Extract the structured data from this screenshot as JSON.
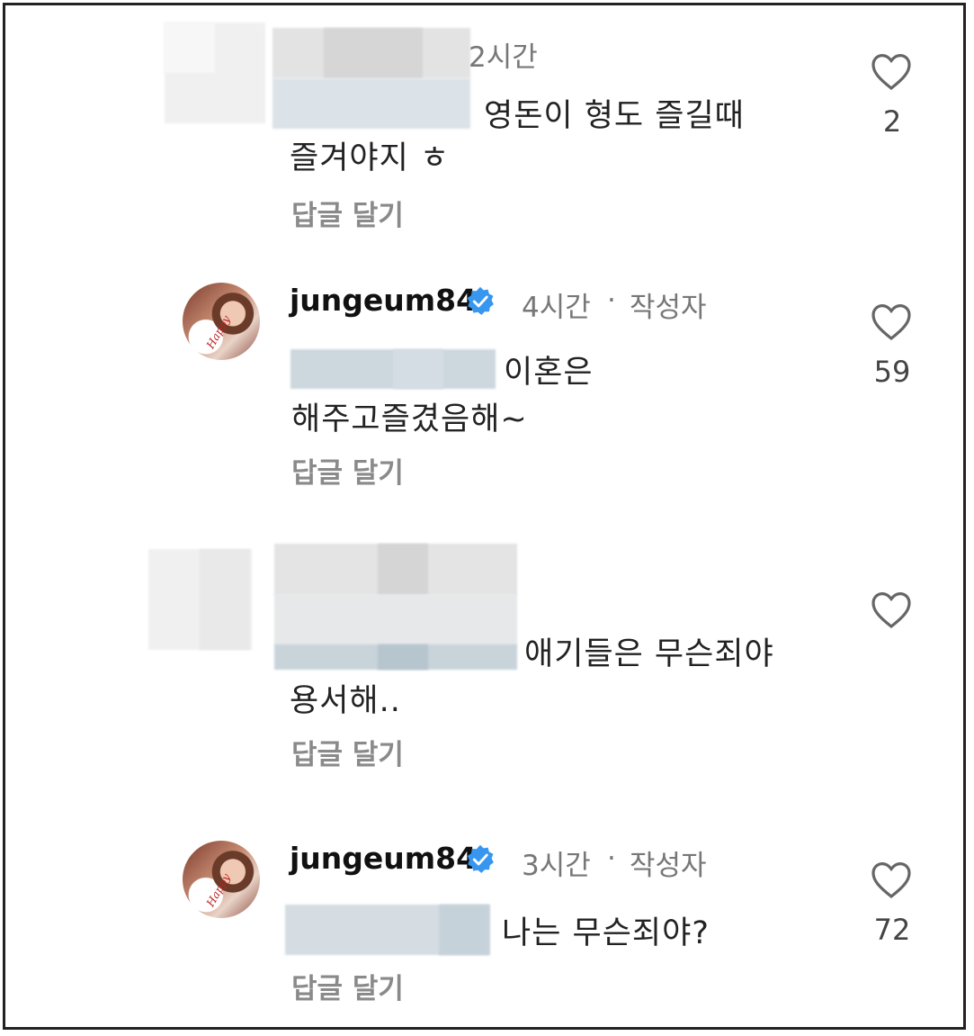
{
  "comments": [
    {
      "time": "2시간",
      "text_line1": "영돈이 형도 즐길때",
      "text_line2": "즐겨야지 ㅎ",
      "reply": "답글 달기",
      "likes": "2"
    },
    {
      "username": "jungeum84",
      "time": "4시간",
      "separator": "·",
      "author_badge": "작성자",
      "text_line1": "이혼은",
      "text_line2": "해주고즐겼음해~",
      "reply": "답글 달기",
      "likes": "59"
    },
    {
      "text_line1": "애기들은 무슨죄야",
      "text_line2": "용서해..",
      "reply": "답글 달기",
      "likes": ""
    },
    {
      "username": "jungeum84",
      "time": "3시간",
      "separator": "·",
      "author_badge": "작성자",
      "text_line1": "나는 무슨죄야?",
      "reply": "답글 달기",
      "likes": "72"
    }
  ],
  "avatar_text": "Happy",
  "colors": {
    "verified": "#3797f0",
    "muted": "#777777",
    "blur_gray": "#e6e6e6",
    "blur_blue": "#cdd7de"
  },
  "icons": {
    "like": "heart-outline-icon",
    "verified": "verified-badge-icon"
  }
}
